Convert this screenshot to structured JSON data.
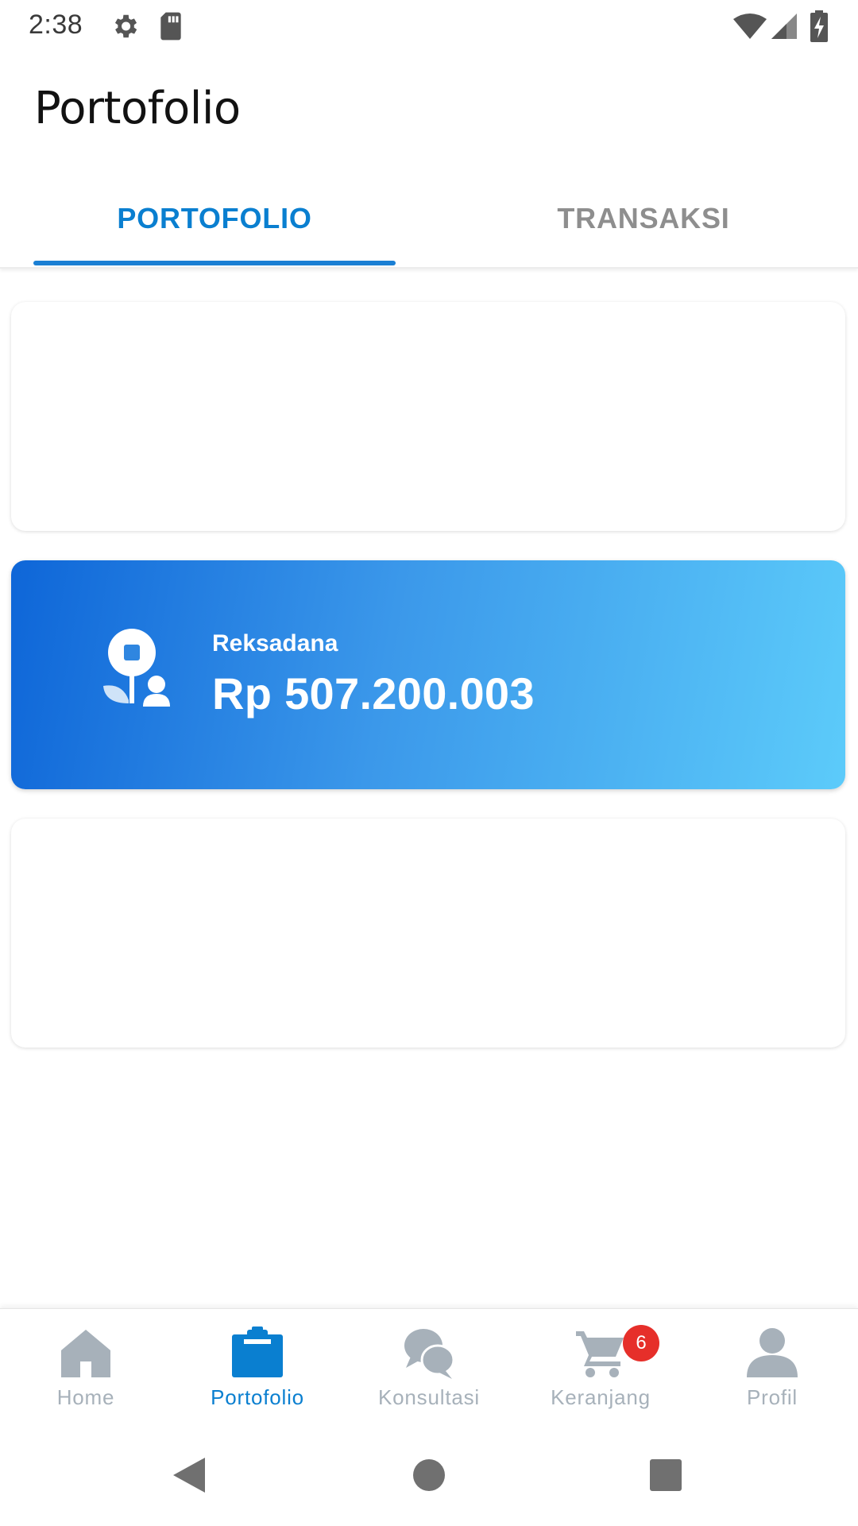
{
  "status_bar": {
    "time": "2:38",
    "icons": [
      "gear-icon",
      "sd-card-icon",
      "wifi-icon",
      "signal-icon",
      "battery-charging-icon"
    ]
  },
  "app_bar": {
    "title": "Portofolio"
  },
  "tabs": [
    {
      "label": "PORTOFOLIO",
      "active": true
    },
    {
      "label": "TRANSAKSI",
      "active": false
    }
  ],
  "portfolio": {
    "fund_card": {
      "label": "Reksadana",
      "value": "Rp 507.200.003",
      "icon": "mutual-fund-icon",
      "gradient_colors": [
        "#0e66d8",
        "#5ccbfa"
      ]
    }
  },
  "bottom_nav": {
    "items": [
      {
        "label": "Home",
        "icon": "home-icon",
        "active": false
      },
      {
        "label": "Portofolio",
        "icon": "clipboard-icon",
        "active": true
      },
      {
        "label": "Konsultasi",
        "icon": "chat-icon",
        "active": false
      },
      {
        "label": "Keranjang",
        "icon": "cart-icon",
        "active": false,
        "badge": "6"
      },
      {
        "label": "Profil",
        "icon": "profile-icon",
        "active": false
      }
    ]
  },
  "colors": {
    "accent": "#0a7fd0",
    "inactive": "#a7b1ba",
    "badge": "#e62f2a"
  }
}
